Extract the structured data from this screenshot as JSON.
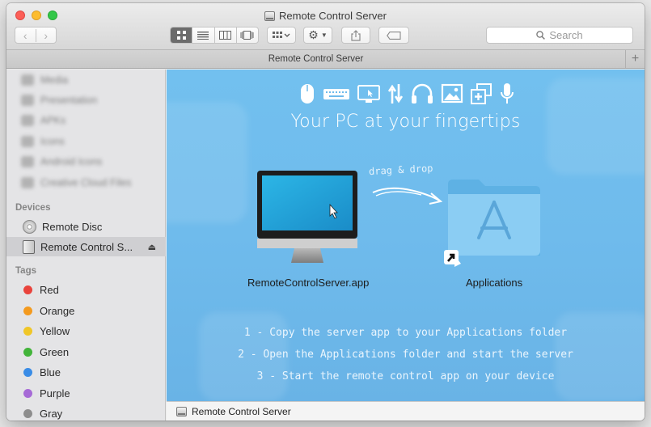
{
  "window": {
    "title": "Remote Control Server"
  },
  "toolbar": {
    "back_icon": "chevron-left-icon",
    "forward_icon": "chevron-right-icon",
    "view_modes": [
      "icon-view",
      "list-view",
      "column-view",
      "cover-flow-view"
    ],
    "active_view": "icon-view",
    "search_placeholder": "Search"
  },
  "tab": {
    "label": "Remote Control Server",
    "add_symbol": "+"
  },
  "sidebar": {
    "favorites_blurred": [
      "Media",
      "Presentation",
      "APKs",
      "Icons",
      "Android Icons",
      "Creative Cloud Files"
    ],
    "devices_heading": "Devices",
    "devices": [
      {
        "label": "Remote Disc",
        "icon": "disc-icon"
      },
      {
        "label": "Remote Control S...",
        "icon": "drive-icon",
        "eject": "⏏"
      }
    ],
    "tags_heading": "Tags",
    "tags": [
      {
        "label": "Red",
        "color": "#e9433c"
      },
      {
        "label": "Orange",
        "color": "#f39a1e"
      },
      {
        "label": "Yellow",
        "color": "#f0c628"
      },
      {
        "label": "Green",
        "color": "#42b43a"
      },
      {
        "label": "Blue",
        "color": "#3a8ce6"
      },
      {
        "label": "Purple",
        "color": "#a66ad6"
      },
      {
        "label": "Gray",
        "color": "#8d8d8d"
      }
    ]
  },
  "content": {
    "feature_icons": [
      "mouse-icon",
      "keyboard-icon",
      "monitor-cursor-icon",
      "up-down-arrows-icon",
      "headphones-icon",
      "image-icon",
      "add-window-icon",
      "microphone-icon"
    ],
    "tagline": "Your PC at your fingertips",
    "drag_hint": "drag & drop",
    "app_label": "RemoteControlServer.app",
    "applications_label": "Applications",
    "instructions": [
      "1 - Copy the server app to your Applications folder",
      "2 - Open the Applications folder and start the server",
      "3 - Start the remote control app on your device"
    ],
    "background_color": "#6fbbec"
  },
  "pathbar": {
    "label": "Remote Control Server"
  }
}
